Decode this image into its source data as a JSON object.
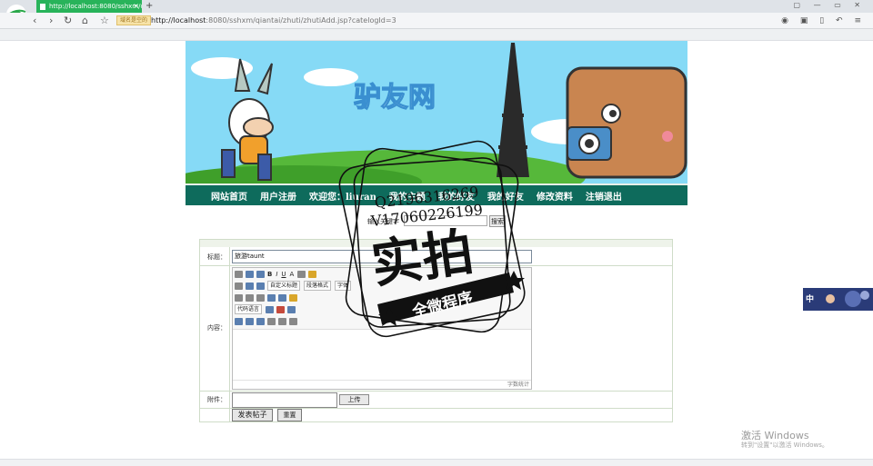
{
  "browser": {
    "tab_title": "http://localhost:8080/sshxm/qi...",
    "tab_close": "×",
    "new_tab": "+",
    "site_badge": "域名是空的",
    "url_host": "http://localhost",
    "url_rest": ":8080/sshxm/qiantai/zhuti/zhutiAdd.jsp?catelogId=3",
    "window_controls": "▢ — ▭ ✕",
    "nav_back": "‹",
    "nav_forward": "›",
    "nav_reload": "↻",
    "nav_home": "⌂",
    "nav_star": "☆",
    "addr_right_icons": "◉ ▣ ▯ ↶ ≡"
  },
  "site": {
    "banner_title": "驴友网",
    "nav_items": [
      "网站首页",
      "用户注册",
      "欢迎您：liuran",
      "我的主题",
      "我的好友",
      "我的好友",
      "修改资料",
      "注销退出"
    ],
    "search_label": "输入关键字",
    "search_value": "",
    "search_button": "搜索"
  },
  "form": {
    "title_label": "标题：",
    "title_value": "旅游taunt",
    "content_label": "内容：",
    "attachment_label": "附件：",
    "upload_button": "上传",
    "submit_button": "发表帖子",
    "reset_button": "重置",
    "editor": {
      "toolbar_row1": [
        "B",
        "I",
        "U",
        "A"
      ],
      "custom_title": "自定义标题",
      "paragraph_format": "段落格式",
      "font_family": "字体",
      "code_language": "代码语言",
      "word_count": "字数统计"
    }
  },
  "watermark": {
    "qq": "Q2196316269",
    "vx": "V17060226199",
    "big_text": "实拍",
    "ribbon_text": "全微程序"
  },
  "side_badge": {
    "label": "中"
  },
  "windows_activation": {
    "line1": "激活 Windows",
    "line2": "转到\"设置\"以激活 Windows。"
  }
}
